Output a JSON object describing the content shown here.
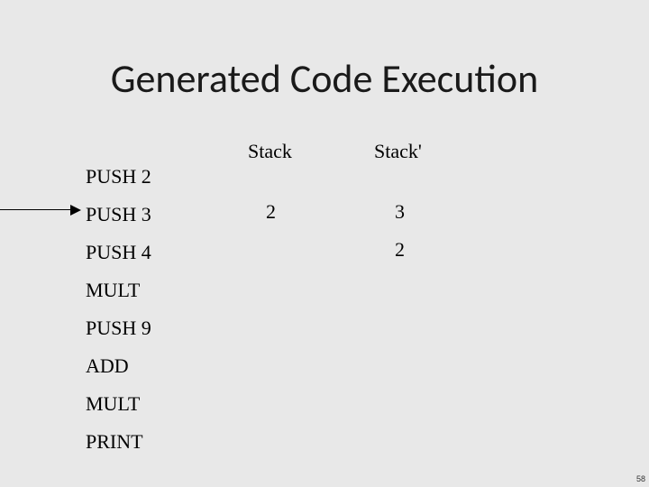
{
  "title": "Generated Code Execution",
  "stack_headers": {
    "left": "Stack",
    "right": "Stack'"
  },
  "instructions": [
    "PUSH 2",
    "PUSH 3",
    "PUSH 4",
    "MULT",
    "PUSH 9",
    "ADD",
    "MULT",
    "PRINT"
  ],
  "stack_before": [
    "2"
  ],
  "stack_after": [
    "3",
    "2"
  ],
  "page_number": "58"
}
